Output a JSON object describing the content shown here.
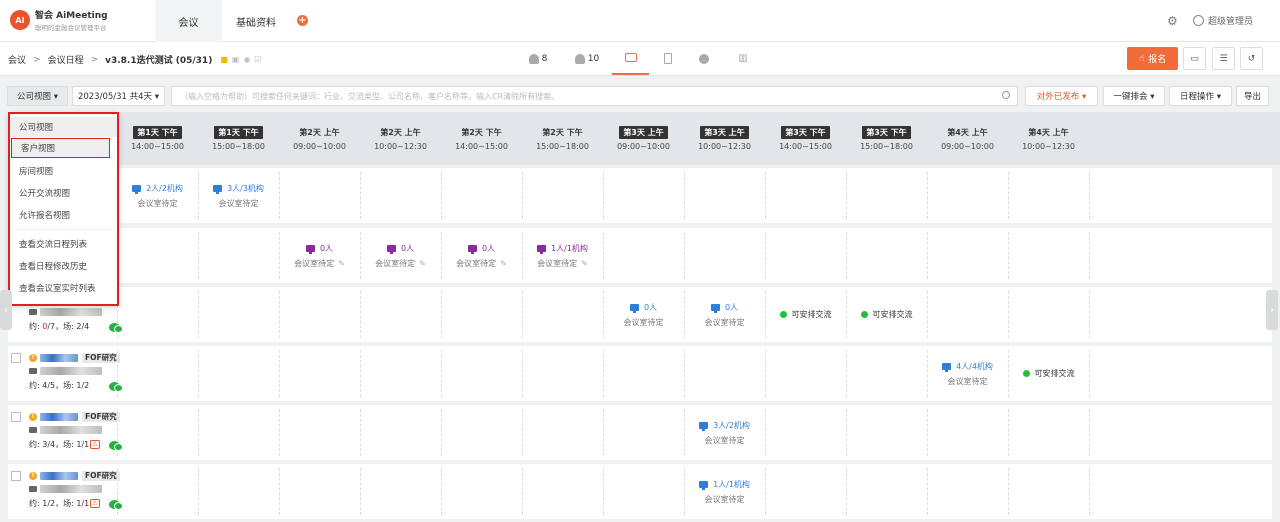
{
  "brand": {
    "name": "智会 AiMeeting",
    "subtitle": "聪明的金融会议管理平台",
    "logo_text": "AI"
  },
  "nav": {
    "tabs": [
      "会议",
      "基础资料"
    ],
    "add": "+"
  },
  "user": {
    "name": "超级管理员"
  },
  "breadcrumb": {
    "items": [
      "会议",
      "会议日程"
    ],
    "current": "v3.8.1迭代测试 (05/31)",
    "sep": ">"
  },
  "view_tabs": [
    {
      "icon": "person-icon",
      "count": "8"
    },
    {
      "icon": "people-icon",
      "count": "10"
    },
    {
      "icon": "calendar-icon",
      "count": ""
    },
    {
      "icon": "document-icon",
      "count": ""
    },
    {
      "icon": "location-icon",
      "count": ""
    },
    {
      "icon": "chart-icon",
      "count": ""
    }
  ],
  "actions": {
    "signup": "报名"
  },
  "filters": {
    "view_select": "公司视图 ▾",
    "date_select": "2023/05/31 共4天 ▾",
    "search_placeholder": "（输入空格为帮助）可搜索任何关键词：行业、交流类型、公司名称、客户名称等。输入CR清除所有搜索。",
    "publish": "对外已发布 ▾",
    "schedule_all": "一键排会 ▾",
    "schedule_ops": "日程操作 ▾",
    "export": "导出"
  },
  "slots": [
    {
      "day": "第1天 下午",
      "time": "14:00~15:00",
      "dark": true
    },
    {
      "day": "第1天 下午",
      "time": "15:00~18:00",
      "dark": true
    },
    {
      "day": "第2天 上午",
      "time": "09:00~10:00",
      "dark": false
    },
    {
      "day": "第2天 上午",
      "time": "10:00~12:30",
      "dark": false
    },
    {
      "day": "第2天 下午",
      "time": "14:00~15:00",
      "dark": false
    },
    {
      "day": "第2天 下午",
      "time": "15:00~18:00",
      "dark": false
    },
    {
      "day": "第3天 上午",
      "time": "09:00~10:00",
      "dark": true
    },
    {
      "day": "第3天 上午",
      "time": "10:00~12:30",
      "dark": true
    },
    {
      "day": "第3天 下午",
      "time": "14:00~15:00",
      "dark": true
    },
    {
      "day": "第3天 下午",
      "time": "15:00~18:00",
      "dark": true
    },
    {
      "day": "第4天 上午",
      "time": "09:00~10:00",
      "dark": false
    },
    {
      "day": "第4天 上午",
      "time": "10:00~12:30",
      "dark": false
    }
  ],
  "cell_labels": {
    "room_pending": "会议室待定",
    "can_arrange": "可安排交流"
  },
  "rows": [
    {
      "tag": "",
      "stats_pre": "",
      "stats_red": "",
      "stats_post": ""
    },
    {
      "tag": "",
      "stats_pre": "",
      "stats_red": "",
      "stats_post": ""
    },
    {
      "tag": "",
      "stats_pre": "约: ",
      "stats_red": "0",
      "stats_post": "/7，场: 2/4"
    },
    {
      "tag": "FOF研究",
      "stats_pre": "约: 4/5，场: 1/2",
      "stats_red": "",
      "stats_post": ""
    },
    {
      "tag": "FOF研究",
      "stats_pre": "约: 3/4，场: 1/1",
      "stats_red": "",
      "stats_post": ""
    },
    {
      "tag": "FOF研究",
      "stats_pre": "约: 1/2，场: 1/1",
      "stats_red": "",
      "stats_post": ""
    }
  ],
  "cells": {
    "r0c0": "2人/2机构",
    "r0c1": "3人/3机构",
    "r1c2": "0人",
    "r1c3": "0人",
    "r1c4": "0人",
    "r1c5": "1人/1机构",
    "r2c6": "0人",
    "r2c7": "0人",
    "r3c10": "4人/4机构",
    "r4c7": "3人/2机构",
    "r5c7": "1人/1机构"
  },
  "dropdown": {
    "items": [
      "公司视图",
      "客户视图",
      "房间视图",
      "公开交流视图",
      "允许报名视图",
      "查看交流日程列表",
      "查看日程修改历史",
      "查看会议室实时列表"
    ]
  },
  "colors": {
    "accent": "#f26b3a",
    "blue": "#2f7fd8",
    "purple": "#8a2a9e",
    "green": "#22c03a",
    "highlight": "#e02020"
  }
}
